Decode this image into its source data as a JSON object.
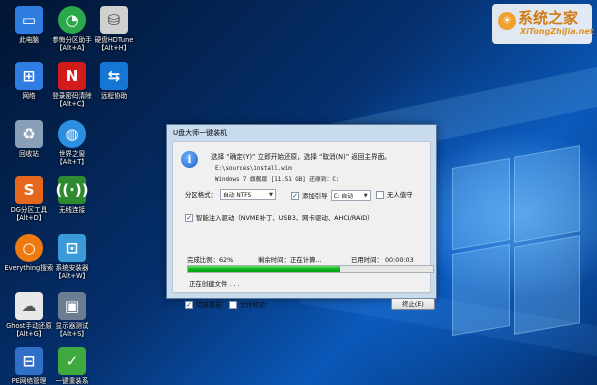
{
  "watermark": {
    "title": "系统之家",
    "domain": "XiTongZhiJia.net"
  },
  "desktop_icons": [
    {
      "label": "此电脑",
      "icon": "this-pc-icon",
      "color": "#2f7de0"
    },
    {
      "label": "参悔分区助手【Alt+A】",
      "icon": "partition-assistant-icon",
      "color": "#2aa84a"
    },
    {
      "label": "硬盘HDTune【Alt+H】",
      "icon": "hdtune-icon",
      "color": "#d0d0d0"
    },
    {
      "label": "网络",
      "icon": "network-icon",
      "color": "#2f7de0"
    },
    {
      "label": "登录密码清除【Alt+C】",
      "icon": "password-reset-icon",
      "color": "#d21c1c"
    },
    {
      "label": "远程协助",
      "icon": "teamviewer-icon",
      "color": "#1576d6"
    },
    {
      "label": "回收站",
      "icon": "recycle-bin-icon",
      "color": "#8aa0b8"
    },
    {
      "label": "世界之窗【Alt+T】",
      "icon": "world-browser-icon",
      "color": "#2c8fe0"
    },
    {
      "label": "DG分区工具【Alt+D】",
      "icon": "diskgenius-icon",
      "color": "#e5671b"
    },
    {
      "label": "无线连接",
      "icon": "wireless-icon",
      "color": "#2f8a2f"
    },
    {
      "label": "Everything搜索",
      "icon": "everything-icon",
      "color": "#ef7b10"
    },
    {
      "label": "系统安装器【Alt+W】",
      "icon": "system-installer-icon",
      "color": "#3a9bd8"
    },
    {
      "label": "Ghost手动还原【Alt+G】",
      "icon": "ghost-icon",
      "color": "#e8e8e8"
    },
    {
      "label": "显示器测试【Alt+S】",
      "icon": "monitor-test-icon",
      "color": "#6b7d90"
    },
    {
      "label": "PE网络管理",
      "icon": "pe-network-icon",
      "color": "#3170c9"
    },
    {
      "label": "一键重装系",
      "icon": "one-click-reinstall-icon",
      "color": "#3fa83f"
    }
  ],
  "dialog": {
    "title": "U盘大师一键装机",
    "message": "选择 “确定(Y)” 立即开始还原，选择 “取消(N)” 返回主界面。",
    "path1": "E:\\sources\\install.wim",
    "path2": "Windows 7 旗舰版 [11.51 GB]  还原到：C:",
    "partition_format_label": "分区格式：",
    "partition_format_value": "自动 NTFS",
    "add_boot_label": "添加引导",
    "add_boot_value": "C: 自动",
    "unattended_label": "无人值守",
    "inject_driver_label": "智能注入驱动（NVME补丁、USB3、网卡驱动、AHCI/RAID）",
    "completion_label": "完成比例：62%",
    "remaining_label": "剩余时间：正在计算...",
    "elapsed_label": "已用时间：  00:00:03",
    "progress": 62,
    "status": "正在创建文件 . . .",
    "restart_label": "完成重启",
    "verify_label": "文件校验",
    "stop_label": "终止(E)"
  }
}
